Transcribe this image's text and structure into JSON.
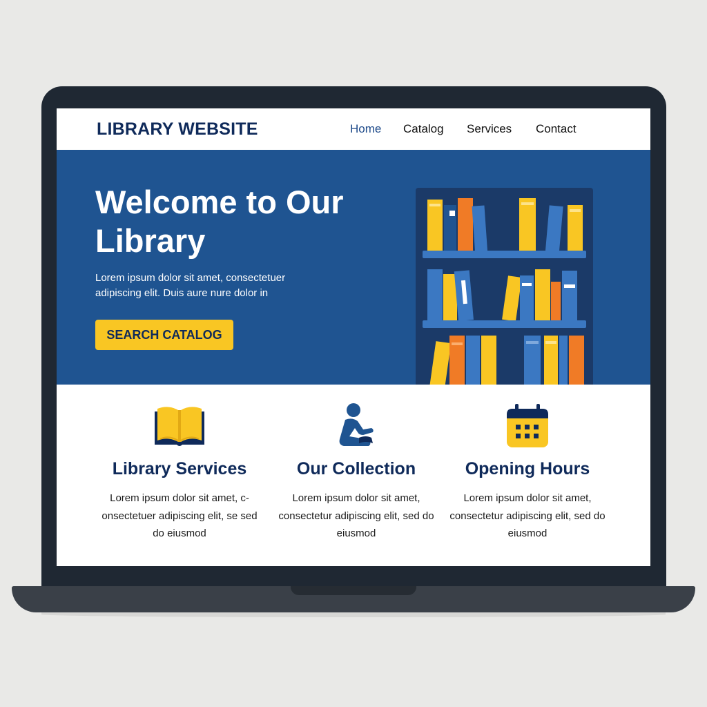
{
  "colors": {
    "brand_navy": "#0f2a5a",
    "hero_blue": "#1f5491",
    "accent_yellow": "#f9c623",
    "accent_orange": "#f07b26",
    "book_blue": "#3b78c2",
    "laptop_frame": "#1f2833"
  },
  "header": {
    "logo_text": "LIBRARY WEBSITE",
    "nav": [
      {
        "label": "Home",
        "active": true
      },
      {
        "label": "Catalog",
        "active": false
      },
      {
        "label": "Services",
        "active": false
      },
      {
        "label": "Contact",
        "active": false
      }
    ]
  },
  "hero": {
    "title": "Welcome to Our Library",
    "text": "Lorem ipsum dolor sit amet, consectetuer adipiscing elit. Duis aure nure dolor in",
    "button_label": "SEARCH CATALOG",
    "illustration_icon": "bookshelf-illustration"
  },
  "features": [
    {
      "icon": "open-book-icon",
      "title": "Library Services",
      "text": "Lorem ipsum dolor sit amet, c-onsectetuer adipiscing elit, se sed do eiusmod"
    },
    {
      "icon": "reading-person-icon",
      "title": "Our Collection",
      "text": "Lorem ipsum dolor sit amet, consectetur adipiscing elit, sed do eiusmod"
    },
    {
      "icon": "calendar-icon",
      "title": "Opening Hours",
      "text": "Lorem ipsum dolor sit amet, consectetur adipiscing elit, sed do eiusmod"
    }
  ]
}
